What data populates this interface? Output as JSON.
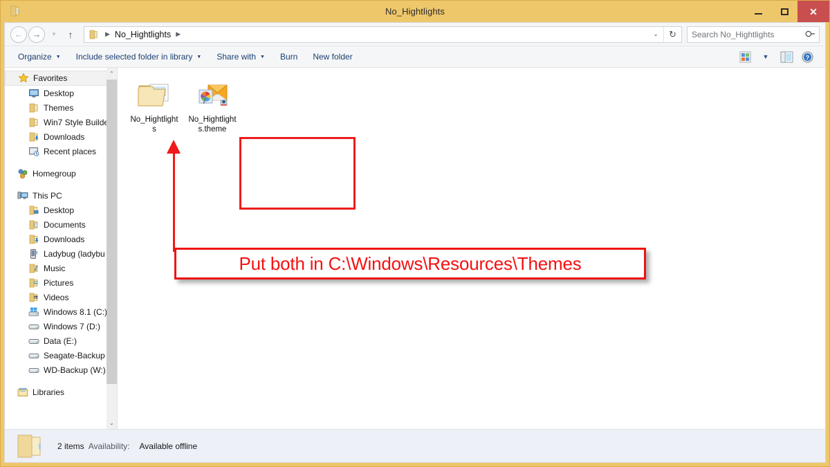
{
  "window": {
    "title": "No_Hightlights",
    "title_icon": "folder-icon",
    "buttons": {
      "minimize": "minimize-button",
      "maximize": "maximize-button",
      "close": "close-button",
      "close_glyph": "✕"
    },
    "accent_titlebar_color": "#efc76b",
    "close_button_color": "#c94f4f"
  },
  "addressbar": {
    "back": "←",
    "forward": "→",
    "recent_caret": "▼",
    "up": "↑",
    "breadcrumb": {
      "root_icon": "folder-icon",
      "separator": "▶",
      "path_name": "No_Hightlights"
    },
    "dropdown": "⌄",
    "refresh": "↻",
    "search_placeholder": "Search No_Hightlights",
    "search_icon": "search-icon"
  },
  "toolbar": {
    "items": [
      {
        "label": "Organize",
        "has_caret": true
      },
      {
        "label": "Include selected folder in library",
        "has_caret": true
      },
      {
        "label": "Share with",
        "has_caret": true
      },
      {
        "label": "Burn",
        "has_caret": false
      },
      {
        "label": "New folder",
        "has_caret": false
      }
    ],
    "right_icons": [
      {
        "name": "change-view-icon"
      },
      {
        "name": "view-dropdown-caret-icon",
        "glyph": "▼"
      },
      {
        "name": "preview-pane-icon"
      },
      {
        "name": "help-icon",
        "glyph": "?"
      }
    ]
  },
  "sidebar": {
    "groups": [
      {
        "header": {
          "label": "Favorites",
          "icon": "star-icon",
          "selected": true
        },
        "items": [
          {
            "label": "Desktop",
            "icon": "desktop-icon"
          },
          {
            "label": "Themes",
            "icon": "folder-icon"
          },
          {
            "label": "Win7 Style Builde",
            "icon": "folder-icon"
          },
          {
            "label": "Downloads",
            "icon": "downloads-folder-icon"
          },
          {
            "label": "Recent places",
            "icon": "recent-places-icon"
          }
        ]
      },
      {
        "header": {
          "label": "Homegroup",
          "icon": "homegroup-icon",
          "selected": false
        },
        "items": []
      },
      {
        "header": {
          "label": "This PC",
          "icon": "computer-icon",
          "selected": false
        },
        "items": [
          {
            "label": "Desktop",
            "icon": "desktop-folder-icon"
          },
          {
            "label": "Documents",
            "icon": "documents-folder-icon"
          },
          {
            "label": "Downloads",
            "icon": "downloads-folder-icon"
          },
          {
            "label": "Ladybug (ladybu",
            "icon": "phone-icon"
          },
          {
            "label": "Music",
            "icon": "music-folder-icon"
          },
          {
            "label": "Pictures",
            "icon": "pictures-folder-icon"
          },
          {
            "label": "Videos",
            "icon": "videos-folder-icon"
          },
          {
            "label": "Windows 8.1 (C:)",
            "icon": "windows-drive-icon"
          },
          {
            "label": "Windows 7 (D:)",
            "icon": "drive-icon"
          },
          {
            "label": "Data (E:)",
            "icon": "drive-icon"
          },
          {
            "label": "Seagate-Backup",
            "icon": "drive-icon"
          },
          {
            "label": "WD-Backup (W:)",
            "icon": "drive-icon"
          }
        ]
      },
      {
        "header": {
          "label": "Libraries",
          "icon": "libraries-icon",
          "selected": false
        },
        "items": []
      }
    ],
    "scroll": {
      "up_arrow": "⌃",
      "down_arrow": "⌄"
    }
  },
  "content": {
    "files": [
      {
        "name": "No_Hightlights",
        "icon": "theme-folder-icon"
      },
      {
        "name": "No_Hightlights.theme",
        "icon": "theme-file-icon"
      }
    ]
  },
  "annotation": {
    "callout_text": "Put both in C:\\Windows\\Resources\\Themes",
    "color": "#f41111",
    "selection_box_color": "#ee1c1c",
    "arrow": "up-arrow-annotation"
  },
  "statusbar": {
    "item_count": "2 items",
    "availability_label": "Availability:",
    "availability_value": "Available offline",
    "icon": "folder-icon"
  }
}
